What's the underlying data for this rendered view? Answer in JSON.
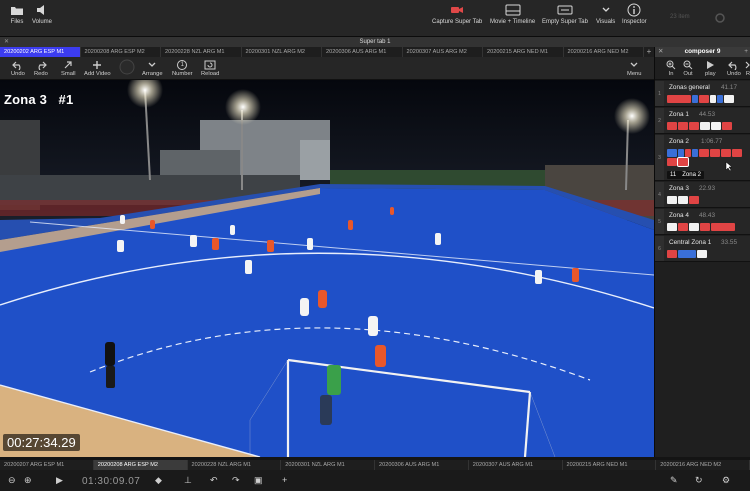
{
  "toolbar": {
    "files": "Files",
    "volume": "Volume",
    "capture_super_tab": "Capture Super Tab",
    "movie_timeline": "Movie + Timeline",
    "empty_super_tab": "Empty Super Tab",
    "visuals": "Visuals",
    "inspector": "Inspector",
    "faded_item": "23 item"
  },
  "super_tab": {
    "label": "Super tab 1"
  },
  "match_tabs": [
    "20200202 ARG ESP M1",
    "20200208 ARG ESP M2",
    "20200228 NZL ARG M1",
    "20200301 NZL ARG M2",
    "20200306 AUS ARG M1",
    "20200307 AUS ARG M2",
    "20200215 ARG NED M1",
    "20200216 ARG NED M2"
  ],
  "video_toolbar": {
    "undo": "Undo",
    "redo": "Redo",
    "small": "Small",
    "add_video": "Add Video",
    "arrange": "Arrange",
    "number": "Number",
    "reload": "Reload",
    "menu": "Menu",
    "number_value": "1"
  },
  "video": {
    "zone_label": "Zona 3",
    "clip_number": "#1",
    "timecode": "00:27:34.29"
  },
  "composer": {
    "title": "composer 9",
    "tools": {
      "zoom_in": "In",
      "zoom_out": "Out",
      "play": "play",
      "undo": "Undo",
      "more": "R"
    },
    "zones": [
      {
        "name": "Zonas general",
        "time": "41.17"
      },
      {
        "name": "Zona 1",
        "time": "44.53"
      },
      {
        "name": "Zona 2",
        "time": "1:06.77",
        "tag_count": "11",
        "tag_name": "Zona 2"
      },
      {
        "name": "Zona 3",
        "time": "22.93"
      },
      {
        "name": "Zona 4",
        "time": "48.43"
      },
      {
        "name": "Central Zona 1",
        "time": "33.55"
      }
    ]
  },
  "bottom_tabs": [
    "20200207 ARG ESP M1",
    "20200208 ARG ESP M2",
    "20200228 NZL ARG M1",
    "20200301 NZL ARG M1",
    "20200306 AUS ARG M1",
    "20200307 AUS ARG M1",
    "20200215 ARG NED M1",
    "20200216 ARG NED M2"
  ],
  "bottom_bar": {
    "timecode": "01:30:09.07"
  },
  "colors": {
    "accent_tab": "#3c3cf0",
    "chip_red": "#e04444",
    "chip_blue": "#3a6fd8",
    "chip_white": "#f2f2f2",
    "pitch_blue": "#1f50c8"
  },
  "icons": [
    "folder-icon",
    "speaker-icon",
    "camera-icon",
    "timeline-icon",
    "keyboard-icon",
    "chevron-down-icon",
    "info-icon",
    "undo-icon",
    "redo-icon",
    "resize-icon",
    "plus-icon",
    "circle-icon",
    "number-icon",
    "reload-icon",
    "zoom-in-icon",
    "zoom-out-icon",
    "play-icon"
  ]
}
